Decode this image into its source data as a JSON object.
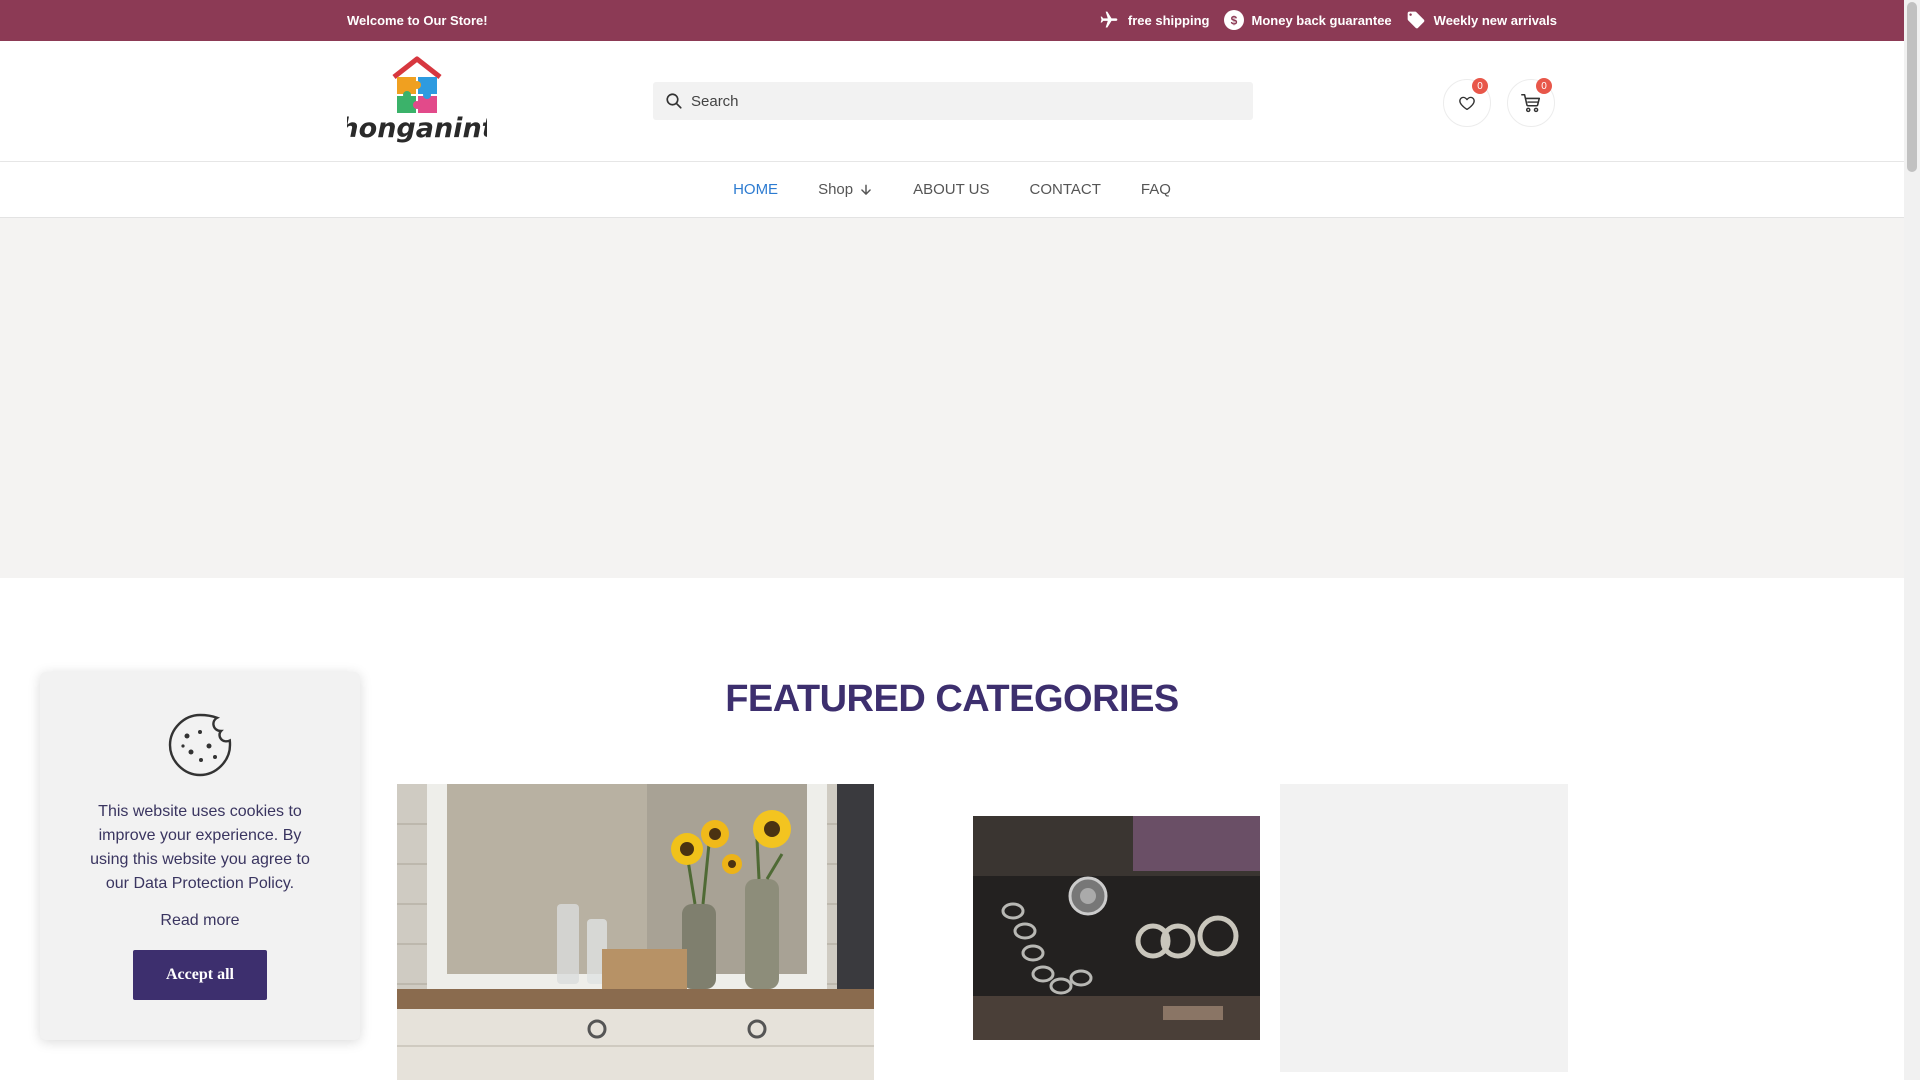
{
  "colors": {
    "topbar": "#8c3a55",
    "brand": "#3d2f6e",
    "accent_blue": "#2c7bd1",
    "badge": "#e8574a"
  },
  "topbar": {
    "welcome": "Welcome to Our Store!",
    "perks": [
      {
        "icon": "plane-icon",
        "label": "free shipping"
      },
      {
        "icon": "dollar-icon",
        "label": "Money back guarantee"
      },
      {
        "icon": "tag-icon",
        "label": "Weekly new arrivals"
      }
    ]
  },
  "header": {
    "logo_text": "honganint",
    "search": {
      "placeholder": "Search",
      "value": ""
    },
    "wishlist_count": "0",
    "cart_count": "0"
  },
  "nav": {
    "items": [
      {
        "label": "HOME",
        "active": true
      },
      {
        "label": "Shop",
        "dropdown": true
      },
      {
        "label": "ABOUT US"
      },
      {
        "label": "CONTACT"
      },
      {
        "label": "FAQ"
      }
    ]
  },
  "featured": {
    "title": "FEATURED CATEGORIES"
  },
  "cookie": {
    "text": "This website uses cookies to improve your experience. By using this website you agree to our Data Protection Policy.",
    "read_more": "Read more",
    "accept": "Accept all"
  }
}
